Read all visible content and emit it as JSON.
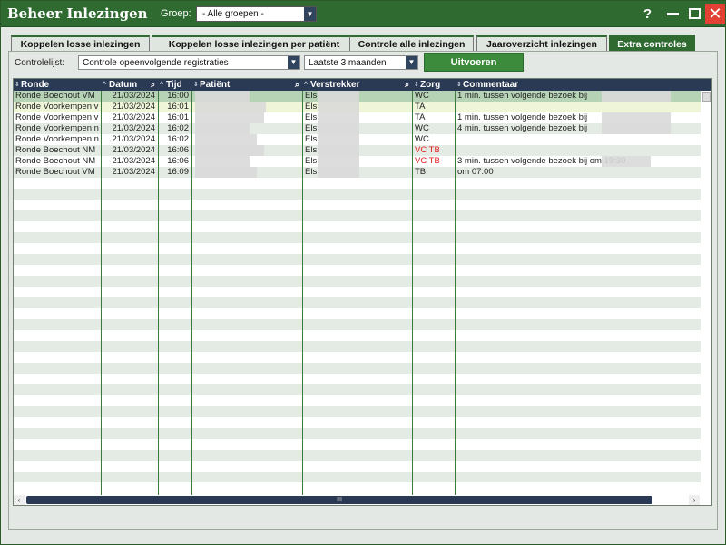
{
  "window": {
    "title": "Beheer Inlezingen"
  },
  "group": {
    "label": "Groep:",
    "value": "- Alle groepen -"
  },
  "titlebar_buttons": {
    "help": "?",
    "close": "✕"
  },
  "tabs": [
    {
      "label": "Koppelen losse inlezingen"
    },
    {
      "label": "Koppelen losse inlezingen per patiënt"
    },
    {
      "label": "Controle alle inlezingen"
    },
    {
      "label": "Jaaroverzicht inlezingen"
    },
    {
      "label": "Extra controles"
    }
  ],
  "controls": {
    "label": "Controlelijst:",
    "list_value": "Controle opeenvolgende registraties",
    "period_value": "Laatste 3 maanden",
    "run_label": "Uitvoeren"
  },
  "columns": [
    "Ronde",
    "Datum",
    "Tijd",
    "Patiënt",
    "Verstrekker",
    "Zorg",
    "Commentaar"
  ],
  "rows": [
    {
      "ronde": "Ronde Boechout VM",
      "datum": "21/03/2024",
      "tijd": "16:00",
      "patient": "",
      "verstrekker": "Els",
      "zorg": "WC",
      "commentaar": "1 min. tussen volgende bezoek bij"
    },
    {
      "ronde": "Ronde Voorkempen v",
      "datum": "21/03/2024",
      "tijd": "16:01",
      "patient": "",
      "verstrekker": "Els",
      "zorg": "TA",
      "commentaar": ""
    },
    {
      "ronde": "Ronde Voorkempen v",
      "datum": "21/03/2024",
      "tijd": "16:01",
      "patient": "",
      "verstrekker": "Els",
      "zorg": "TA",
      "commentaar": "1 min. tussen volgende bezoek bij"
    },
    {
      "ronde": "Ronde Voorkempen n",
      "datum": "21/03/2024",
      "tijd": "16:02",
      "patient": "",
      "verstrekker": "Els",
      "zorg": "WC",
      "commentaar": "4 min. tussen volgende bezoek bij"
    },
    {
      "ronde": "Ronde Voorkempen n",
      "datum": "21/03/2024",
      "tijd": "16:02",
      "patient": "",
      "verstrekker": "Els",
      "zorg": "WC",
      "commentaar": ""
    },
    {
      "ronde": "Ronde Boechout NM",
      "datum": "21/03/2024",
      "tijd": "16:06",
      "patient": "",
      "verstrekker": "Els",
      "zorg": "VC TB",
      "commentaar": ""
    },
    {
      "ronde": "Ronde Boechout NM",
      "datum": "21/03/2024",
      "tijd": "16:06",
      "patient": "",
      "verstrekker": "Els",
      "zorg": "VC TB",
      "commentaar": "3 min. tussen volgende bezoek bij            om 19:30"
    },
    {
      "ronde": "Ronde Boechout VM",
      "datum": "21/03/2024",
      "tijd": "16:09",
      "patient": "",
      "verstrekker": "Els",
      "zorg": "TB",
      "commentaar": " om 07:00"
    }
  ],
  "colors": {
    "accent": "#2f6b31",
    "header": "#2a3a55",
    "alert": "#e02020"
  },
  "scroll_label": "III"
}
